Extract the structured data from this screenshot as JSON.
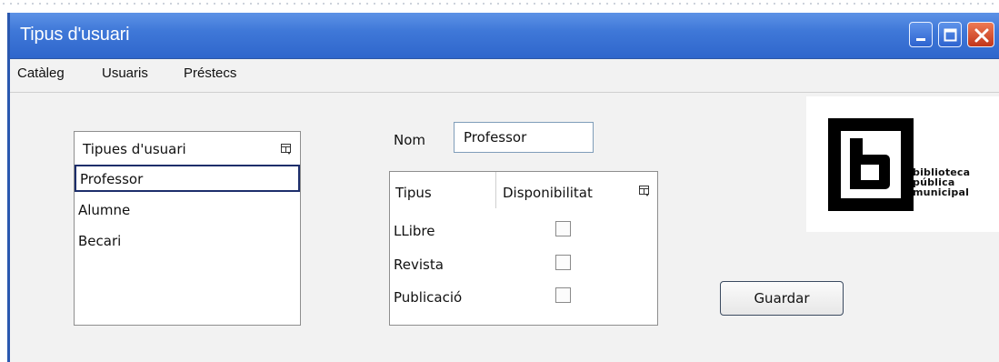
{
  "window": {
    "title": "Tipus d'usuari",
    "controls": {
      "minimize": "minimize-icon",
      "maximize": "maximize-icon",
      "close": "close-icon"
    }
  },
  "menu": {
    "items": [
      {
        "label": "Catàleg"
      },
      {
        "label": "Usuaris"
      },
      {
        "label": "Préstecs"
      }
    ]
  },
  "user_types": {
    "header": "Tipues d'usuari",
    "items": [
      {
        "label": "Professor",
        "selected": true
      },
      {
        "label": "Alumne",
        "selected": false
      },
      {
        "label": "Becari",
        "selected": false
      }
    ]
  },
  "form": {
    "nom_label": "Nom",
    "nom_value": "Professor"
  },
  "availability_table": {
    "headers": [
      "Tipus",
      "Disponibilitat"
    ],
    "rows": [
      {
        "tipus": "LLibre",
        "disponibilitat": false
      },
      {
        "tipus": "Revista",
        "disponibilitat": false
      },
      {
        "tipus": "Publicació",
        "disponibilitat": false
      }
    ]
  },
  "actions": {
    "save_label": "Guardar"
  },
  "logo": {
    "line1": "biblioteca",
    "line2": "pública",
    "line3": "municipal"
  },
  "colors": {
    "titlebar": "#3f78d8",
    "close_button": "#c2361a",
    "selection_border": "#1d2e6b"
  }
}
